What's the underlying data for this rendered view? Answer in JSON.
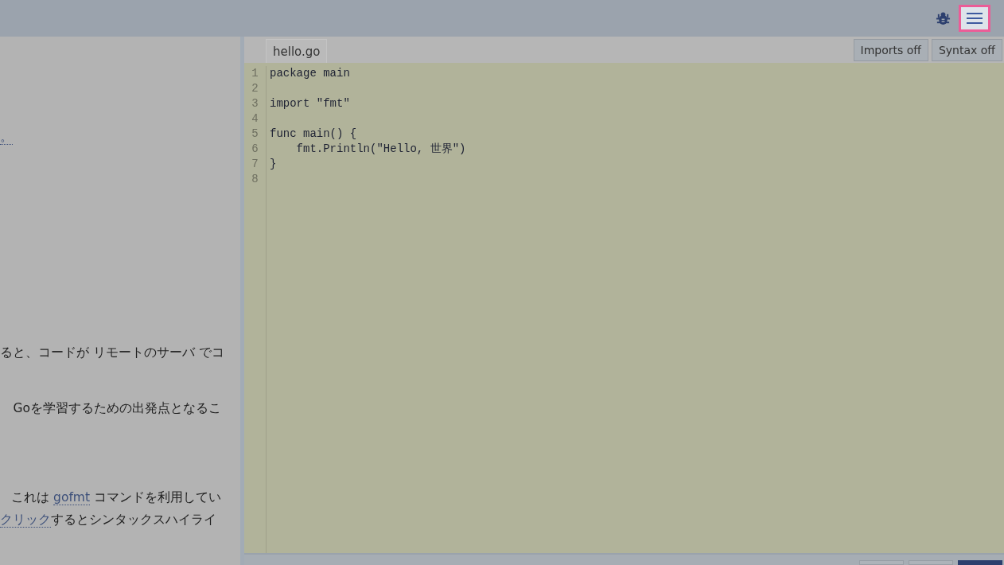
{
  "header": {
    "menu_button": {
      "highlighted": true
    }
  },
  "left_panel": {
    "paragraphs": [
      {
        "segments": [
          {
            "text": "。",
            "link": true
          }
        ]
      },
      {
        "segments": [
          {
            "text": "ると、コードが リモートのサーバ でコ",
            "link": false
          }
        ]
      },
      {
        "segments": [
          {
            "text": "Goを学習するための出発点となるこ",
            "link": false
          }
        ]
      },
      {
        "segments": [
          {
            "text": "これは ",
            "link": false
          },
          {
            "text": "gofmt",
            "link": true
          },
          {
            "text": " コマンドを利用してい",
            "link": false
          }
        ]
      },
      {
        "segments": [
          {
            "text": "クリック",
            "link": true
          },
          {
            "text": "するとシンタックスハイライ",
            "link": false
          }
        ]
      }
    ]
  },
  "editor": {
    "tabs": [
      {
        "label": "hello.go",
        "selected": true
      }
    ],
    "toggles": [
      {
        "label": "Imports off"
      },
      {
        "label": "Syntax off"
      }
    ],
    "lines": [
      {
        "number": "1",
        "code": "package main"
      },
      {
        "number": "2"
      },
      {
        "number": "3",
        "code": "import \"fmt\""
      },
      {
        "number": "4"
      },
      {
        "number": "5",
        "code": "func main() {"
      },
      {
        "number": "6",
        "code": "    fmt.Println(\"Hello, 世界\")"
      },
      {
        "number": "7",
        "code": "}"
      },
      {
        "number": "8"
      }
    ]
  },
  "footer_buttons": [
    {
      "primary": false
    },
    {
      "primary": false
    },
    {
      "primary": true
    }
  ]
}
